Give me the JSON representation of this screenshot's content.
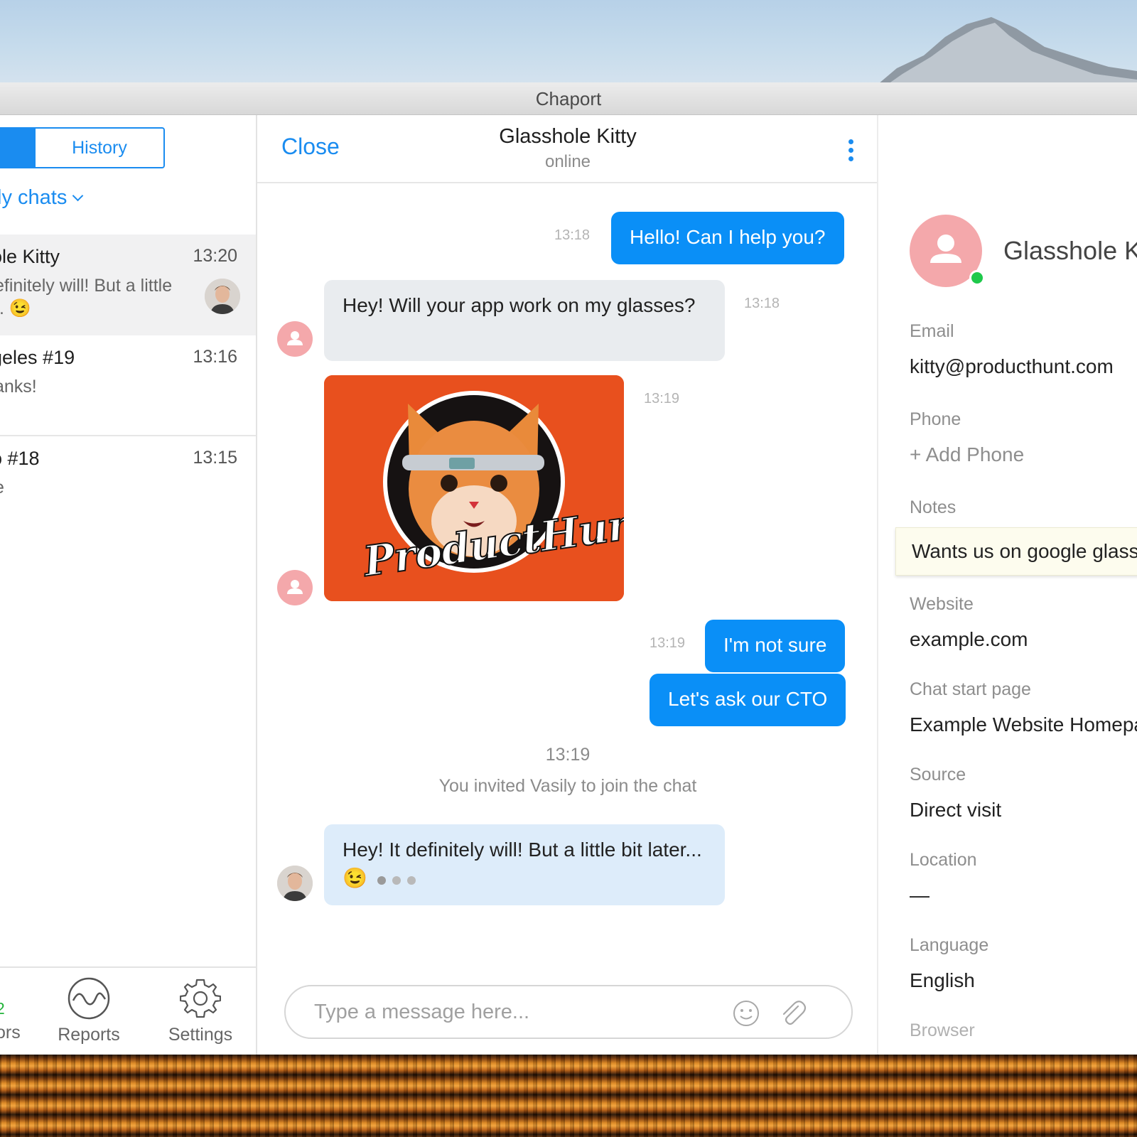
{
  "app": {
    "title": "Chaport"
  },
  "left": {
    "tabs": {
      "history": "History"
    },
    "filter": "ly chats",
    "chats": [
      {
        "name": "ole Kitty",
        "time": "13:20",
        "preview_line1": "efinitely will! But a little",
        "preview_line2": ".. 😉",
        "active": true
      },
      {
        "name": "geles #19",
        "time": "13:16",
        "preview_line1": "anks!",
        "preview_line2": ""
      },
      {
        "name": "o #18",
        "time": "13:15",
        "preview_line1": "e",
        "preview_line2": ""
      }
    ],
    "nav": {
      "visitors_count": "2",
      "visitors_label": "ors",
      "reports_label": "Reports",
      "settings_label": "Settings"
    }
  },
  "chat": {
    "close_label": "Close",
    "contact_name": "Glasshole Kitty",
    "status": "online",
    "messages": {
      "m1": {
        "text": "Hello! Can I help you?",
        "time": "13:18"
      },
      "m2": {
        "text": "Hey! Will your app work on my glasses?",
        "time": "13:18"
      },
      "m3": {
        "caption": "ProductHunt",
        "time": "13:19"
      },
      "m4": {
        "text": "I'm not sure",
        "time": "13:19"
      },
      "m5": {
        "text": "Let's ask our CTO"
      },
      "sys_time": "13:19",
      "sys_text": "You invited Vasily to join the chat",
      "m6": {
        "text": "Hey! It definitely will! But a little bit later... 😉"
      }
    },
    "composer_placeholder": "Type a message here..."
  },
  "profile": {
    "name": "Glasshole Kitty",
    "email_label": "Email",
    "email": "kitty@producthunt.com",
    "phone_label": "Phone",
    "phone_add": "+ Add Phone",
    "notes_label": "Notes",
    "notes": "Wants us on google glass",
    "website_label": "Website",
    "website": "example.com",
    "start_page_label": "Chat start page",
    "start_page": "Example Website Homepage",
    "source_label": "Source",
    "source": "Direct visit",
    "location_label": "Location",
    "location": "—",
    "language_label": "Language",
    "language": "English",
    "browser_label": "Browser"
  },
  "colors": {
    "accent": "#1a8cf0",
    "outgoing": "#0a8ff7",
    "incoming": "#e9ecef",
    "online": "#1ec94b",
    "visitor_avatar": "#f4a8ab"
  }
}
